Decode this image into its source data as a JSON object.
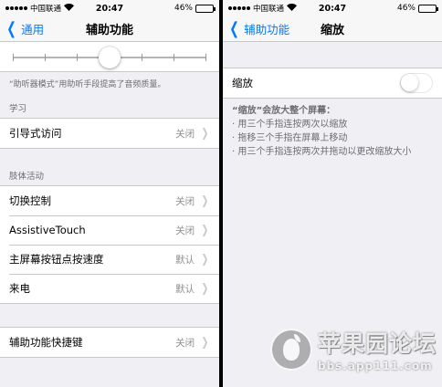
{
  "left": {
    "status": {
      "carrier": "中国联通",
      "time": "20:47",
      "battery": "46%",
      "battery_level": 0.46
    },
    "nav": {
      "back": "通用",
      "title": "辅助功能"
    },
    "hearing_slider": {
      "value": 0.5,
      "ticks": 7
    },
    "hearing_footnote": "“助听器模式”用助听手段提高了音频质量。",
    "learning": {
      "header": "学习",
      "items": [
        {
          "label": "引导式访问",
          "value": "关闭"
        }
      ]
    },
    "physical": {
      "header": "肢体活动",
      "items": [
        {
          "label": "切换控制",
          "value": "关闭"
        },
        {
          "label": "AssistiveTouch",
          "value": "关闭"
        },
        {
          "label": "主屏幕按钮点按速度",
          "value": "默认"
        },
        {
          "label": "来电",
          "value": "默认"
        }
      ]
    },
    "shortcut": {
      "items": [
        {
          "label": "辅助功能快捷键",
          "value": "关闭"
        }
      ]
    }
  },
  "right": {
    "status": {
      "carrier": "中国联通",
      "time": "20:47",
      "battery": "46%",
      "battery_level": 0.46
    },
    "nav": {
      "back": "辅助功能",
      "title": "缩放"
    },
    "zoom_toggle": {
      "label": "缩放",
      "on": false
    },
    "zoom_description": {
      "heading": "“缩放”会放大整个屏幕：",
      "lines": [
        "· 用三个手指连按两次以缩放",
        "· 拖移三个手指在屏幕上移动",
        "· 用三个手指连按两次并拖动以更改缩放大小"
      ]
    },
    "watermark": {
      "title": "苹果园论坛",
      "url": "bbs.app111.com"
    }
  },
  "colors": {
    "accent": "#007aff",
    "background": "#efeff4",
    "secondary_text": "#8e8e93"
  }
}
